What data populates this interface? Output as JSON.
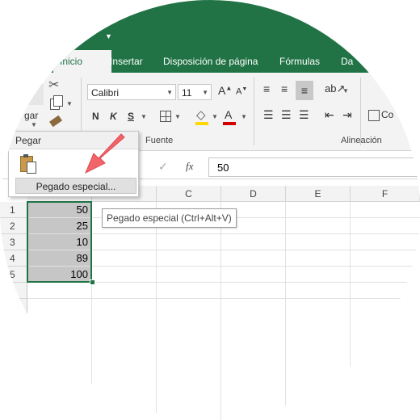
{
  "colors": {
    "excel_green": "#217346",
    "ribbon_bg": "#f3f3f3",
    "selection": "#c6c6c6",
    "arrow": "#f0646a",
    "font_red": "#d40000",
    "fill_yellow": "#ffd700"
  },
  "tabs": [
    {
      "label": "Inicio",
      "active": true
    },
    {
      "label": "Insertar"
    },
    {
      "label": "Disposición de página"
    },
    {
      "label": "Fórmulas"
    },
    {
      "label": "Da"
    }
  ],
  "ribbon": {
    "font_name": "Calibri",
    "font_size": "11",
    "bold": "N",
    "italic": "K",
    "underline": "S",
    "grow_font": "A",
    "shrink_font": "A",
    "font_color_letter": "A",
    "fuente_label": "Fuente",
    "alineacion_label": "Alineación",
    "wrap_label_partial": "Co",
    "paste_partial": "gar"
  },
  "formula_bar": {
    "value": "50",
    "fx": "fx",
    "check": "✓"
  },
  "columns": [
    "C",
    "D",
    "E",
    "F"
  ],
  "rows": [
    {
      "num": "1",
      "a": "50"
    },
    {
      "num": "2",
      "a": "25"
    },
    {
      "num": "3",
      "a": "10"
    },
    {
      "num": "4",
      "a": "89"
    },
    {
      "num": "5",
      "a": "100"
    }
  ],
  "paste_menu": {
    "header": "Pegar",
    "item": "Pegado especial..."
  },
  "tooltip": "Pegado especial (Ctrl+Alt+V)"
}
